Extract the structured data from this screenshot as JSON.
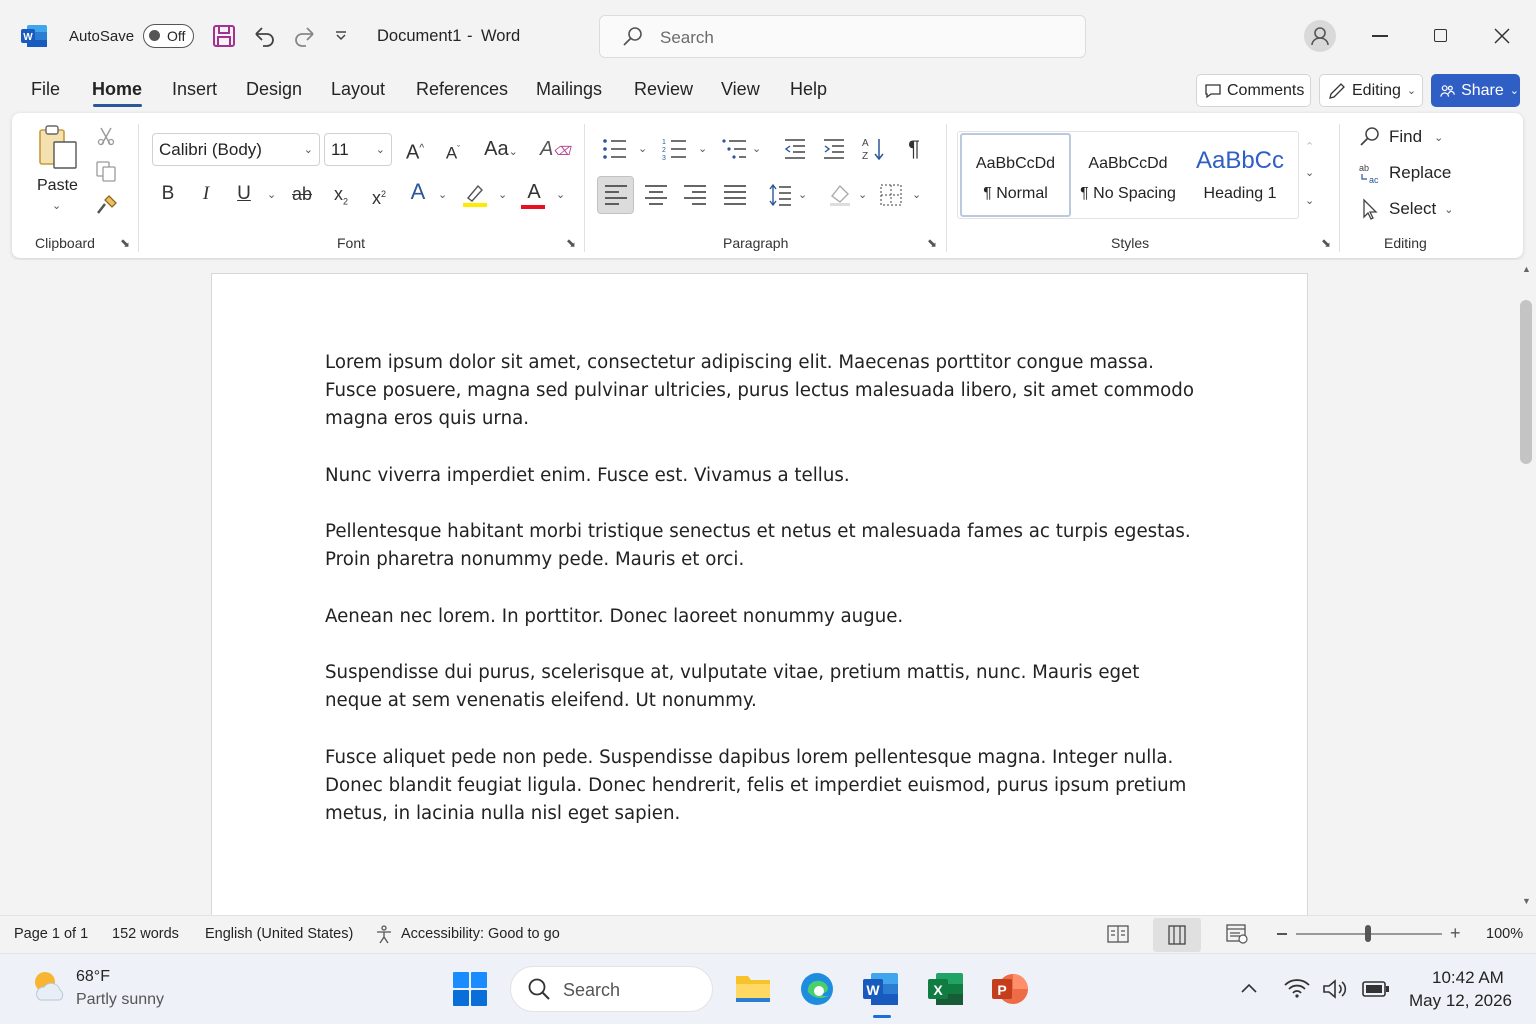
{
  "titlebar": {
    "autosave_label": "AutoSave",
    "autosave_state": "Off",
    "document_title": "Document1",
    "title_sep": "-",
    "app_name": "Word",
    "search_placeholder": "Search"
  },
  "menu": {
    "tabs": [
      "File",
      "Home",
      "Insert",
      "Design",
      "Layout",
      "References",
      "Mailings",
      "Review",
      "View",
      "Help"
    ],
    "active_tab": "Home",
    "comments_label": "Comments",
    "editing_label": "Editing",
    "share_label": "Share"
  },
  "ribbon": {
    "clipboard": {
      "paste_label": "Paste",
      "group_label": "Clipboard"
    },
    "font": {
      "font_name": "Calibri (Body)",
      "font_size": "11",
      "group_label": "Font",
      "case_label": "Aa"
    },
    "paragraph": {
      "group_label": "Paragraph"
    },
    "styles": {
      "group_label": "Styles",
      "items": [
        {
          "preview": "AaBbCcDd",
          "name": "¶ Normal"
        },
        {
          "preview": "AaBbCcDd",
          "name": "¶ No Spacing"
        },
        {
          "preview": "AaBbCc",
          "name": "Heading 1"
        }
      ]
    },
    "editing": {
      "find_label": "Find",
      "replace_label": "Replace",
      "select_label": "Select",
      "group_label": "Editing"
    }
  },
  "document": {
    "paragraphs": [
      "Lorem ipsum dolor sit amet, consectetur adipiscing elit. Maecenas porttitor congue massa. Fusce posuere, magna sed pulvinar ultricies, purus lectus malesuada libero, sit amet commodo magna eros quis urna.",
      "Nunc viverra imperdiet enim. Fusce est. Vivamus a tellus.",
      "Pellentesque habitant morbi tristique senectus et netus et malesuada fames ac turpis egestas. Proin pharetra nonummy pede. Mauris et orci.",
      "Aenean nec lorem. In porttitor. Donec laoreet nonummy augue.",
      "Suspendisse dui purus, scelerisque at, vulputate vitae, pretium mattis, nunc. Mauris eget neque at sem venenatis eleifend. Ut nonummy.",
      "Fusce aliquet pede non pede. Suspendisse dapibus lorem pellentesque magna. Integer nulla. Donec blandit feugiat ligula. Donec hendrerit, felis et imperdiet euismod, purus ipsum pretium metus, in lacinia nulla nisl eget sapien."
    ]
  },
  "status": {
    "page": "Page 1 of 1",
    "words": "152 words",
    "language": "English (United States)",
    "accessibility": "Accessibility: Good to go",
    "zoom": "100%"
  },
  "taskbar": {
    "weather_temp": "68°F",
    "weather_desc": "Partly sunny",
    "search_placeholder": "Search",
    "time": "10:42 AM",
    "date": "May 12, 2026"
  },
  "colors": {
    "accent": "#2b579a",
    "share_bg": "#2f5ec4",
    "save_icon": "#a4318f",
    "highlight_bar": "#ffeb00",
    "font_color_bar": "#e81123"
  }
}
